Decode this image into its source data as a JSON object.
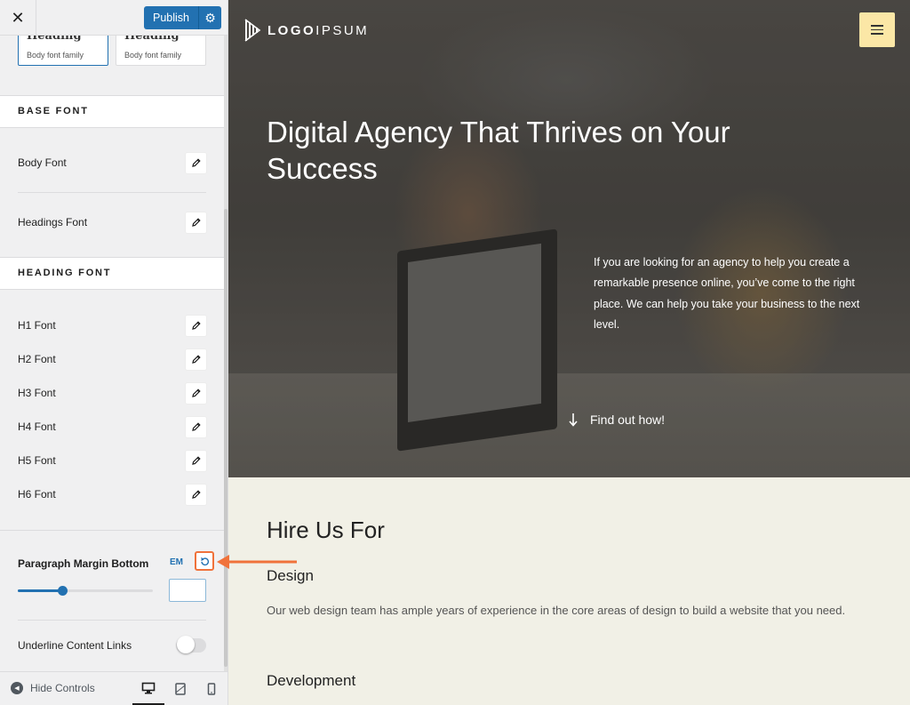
{
  "sidebar": {
    "publish_label": "Publish",
    "presets": [
      {
        "title": "Heading",
        "subtitle": "Body font family"
      },
      {
        "title": "Heading",
        "subtitle": "Body font family"
      }
    ],
    "base_font": {
      "heading": "BASE FONT",
      "items": [
        "Body Font",
        "Headings Font"
      ]
    },
    "heading_font": {
      "heading": "HEADING FONT",
      "items": [
        "H1 Font",
        "H2 Font",
        "H3 Font",
        "H4 Font",
        "H5 Font",
        "H6 Font"
      ]
    },
    "paragraph_margin": {
      "label": "Paragraph Margin Bottom",
      "unit": "EM",
      "slider_fraction": 0.33,
      "value": ""
    },
    "underline_links": {
      "label": "Underline Content Links",
      "enabled": false
    },
    "footer": {
      "hide_controls": "Hide Controls",
      "devices": [
        "desktop-icon",
        "tablet-icon",
        "mobile-icon"
      ],
      "active_device": "desktop"
    }
  },
  "preview": {
    "logo": {
      "bold": "LOGO",
      "light": "IPSUM"
    },
    "hero_title": "Digital Agency That Thrives on Your Success",
    "hero_text": "If you are looking for an agency to help you create a remarkable presence online, you’ve come to the right place. We can help you take your business to the next level.",
    "cta": "Find out how!",
    "section_title": "Hire Us For",
    "services": [
      {
        "title": "Design",
        "text": "Our web design team has ample years of experience in the core areas of design to build a website that you need."
      },
      {
        "title": "Development"
      }
    ]
  },
  "colors": {
    "accent": "#2271b1",
    "annotation_arrow": "#f0723b",
    "hamburger_bg": "#fbe7a6",
    "content_bg": "#f1f0e6"
  }
}
